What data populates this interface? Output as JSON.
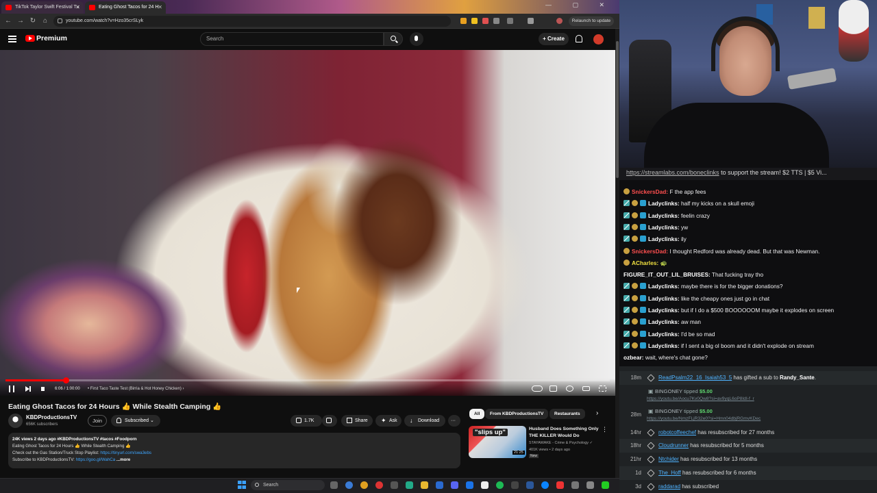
{
  "browser": {
    "tabs": [
      {
        "label": "TikTok Taylor Swift Festival Tu",
        "active": false
      },
      {
        "label": "Eating Ghost Tacos for 24 H",
        "active": true
      }
    ],
    "window_controls": "— ▢ ✕",
    "url": "youtube.com/watch?v=Hzo35crSLyk",
    "relaunch_label": "Relaunch to update"
  },
  "youtube": {
    "brand": "Premium",
    "search_placeholder": "Search",
    "create_label": "+ Create",
    "video": {
      "time": "6:06 / 1:00:00",
      "chapter": "• First Taco Taste Test (Birria & Hot Honey Chicken) ›",
      "progress_fraction": 0.1
    },
    "title": "Eating Ghost Tacos for 24 Hours 👍 While Stealth Camping 👍",
    "channel": {
      "name": "KBDProductionsTV",
      "subscribers": "656K subscribers"
    },
    "join_label": "Join",
    "subscribed_label": "Subscribed ⌄",
    "actions": {
      "likes": "1.7K",
      "share": "Share",
      "ask": "Ask",
      "download": "Download",
      "more": "···"
    },
    "description": {
      "stats": "24K views  2 days ago  #KBDProductionsTV #tacos #Foodporn",
      "line1": "Eating Ghost Tacos for 24 Hours 👍 While Stealth Camping 👍",
      "line2_prefix": "Check out the Gas Station/Truck Stop Playlist: ",
      "line2_link": "https://tinyurl.com/swa3ebs",
      "line3_prefix": "Subscribe to KBDProductionsTV: ",
      "line3_link": "https://goo.gl/WahCa",
      "more": "...more"
    },
    "chips": [
      "All",
      "From KBDProductionsTV",
      "Restaurants"
    ],
    "recommendation": {
      "thumb_text": "\"slips up\"",
      "duration": "21:25",
      "title": "Husband Does Something Only THE KILLER Would Do",
      "channel": "STAYAWAKE - Crime & Psychology ✓",
      "meta": "401K views • 2 days ago",
      "badge": "New"
    }
  },
  "chat": {
    "banner_link": "https://streamlabs.com/boneclinks",
    "banner_rest": " to support the stream! $2 TTS | $5 Vi...",
    "messages": [
      {
        "user": "SnickersDad:",
        "text": " F the app fees",
        "color": "#ff4f4f",
        "badges": "dot"
      },
      {
        "user": "Ladyclinks:",
        "text": " half my kicks on a skull emoji",
        "color": "#ffffff",
        "badges": "mod"
      },
      {
        "user": "Ladyclinks:",
        "text": " feelin crazy",
        "color": "#ffffff",
        "badges": "mod"
      },
      {
        "user": "Ladyclinks:",
        "text": " yw",
        "color": "#ffffff",
        "badges": "mod"
      },
      {
        "user": "Ladyclinks:",
        "text": " ily",
        "color": "#ffffff",
        "badges": "mod"
      },
      {
        "user": "SnickersDad:",
        "text": " I thought Redford was already dead. But that was Newman.",
        "color": "#ff4f4f",
        "badges": "dot"
      },
      {
        "user": "ACharles:",
        "text": " 🐢",
        "color": "#f0e040",
        "badges": "dot"
      },
      {
        "user": "FIGURE_IT_OUT_LIL_BRUISES:",
        "text": " That fucking tray tho",
        "color": "#ffffff",
        "badges": "none"
      },
      {
        "user": "Ladyclinks:",
        "text": " maybe there is for the bigger donations?",
        "color": "#ffffff",
        "badges": "mod"
      },
      {
        "user": "Ladyclinks:",
        "text": " like the cheapy ones just go in chat",
        "color": "#ffffff",
        "badges": "mod"
      },
      {
        "user": "Ladyclinks:",
        "text": " but if I do a $500 BOOOOOOM maybe it explodes on screen",
        "color": "#ffffff",
        "badges": "mod"
      },
      {
        "user": "Ladyclinks:",
        "text": " aw man",
        "color": "#ffffff",
        "badges": "mod"
      },
      {
        "user": "Ladyclinks:",
        "text": " I'd be so mad",
        "color": "#ffffff",
        "badges": "mod"
      },
      {
        "user": "Ladyclinks:",
        "text": " if I sent a big ol boom and it didn't explode on stream",
        "color": "#ffffff",
        "badges": "mod"
      },
      {
        "user": "ozbear:",
        "text": " wait, where's chat gone?",
        "color": "#ffffff",
        "badges": "none"
      }
    ]
  },
  "events": {
    "gift": {
      "ago": "18m",
      "name": "ReadPsalm22_16_Isaiah53_5",
      "mid": " has gifted a sub to ",
      "target": "Randy_Sante",
      "end": "."
    },
    "tips": [
      {
        "name": "BINGONEY",
        "mid": " tipped ",
        "amount": "$5.00",
        "msg": "https://youtu.be/Aocu7Kv0Qw8?si=av9yqL6oP8IdI-f_r"
      },
      {
        "name": "BINGONEY",
        "mid": " tipped ",
        "amount": "$5.00",
        "msg": "https://youtu.be/NmzFLjR32e0?si=Hmn04dbjRGmvKDec"
      }
    ],
    "tip_ago_2": "28m",
    "resubs": [
      {
        "ago": "14hr",
        "name": "robotcoffeechef",
        "text": " has resubscribed for 27 months"
      },
      {
        "ago": "18hr",
        "name": "Cloudrunner",
        "text": " has resubscribed for 5 months"
      },
      {
        "ago": "21hr",
        "name": "Ntchider",
        "text": " has resubscribed for 13 months"
      },
      {
        "ago": "1d",
        "name": "The_Hoff",
        "text": " has resubscribed for 6 months"
      },
      {
        "ago": "3d",
        "name": "raddarad",
        "text": " has subscribed"
      }
    ]
  },
  "taskbar": {
    "search_placeholder": "Search"
  },
  "colors": {
    "accent": "#ff0000",
    "link": "#3ea6ff",
    "tip_green": "#5fd86f"
  }
}
